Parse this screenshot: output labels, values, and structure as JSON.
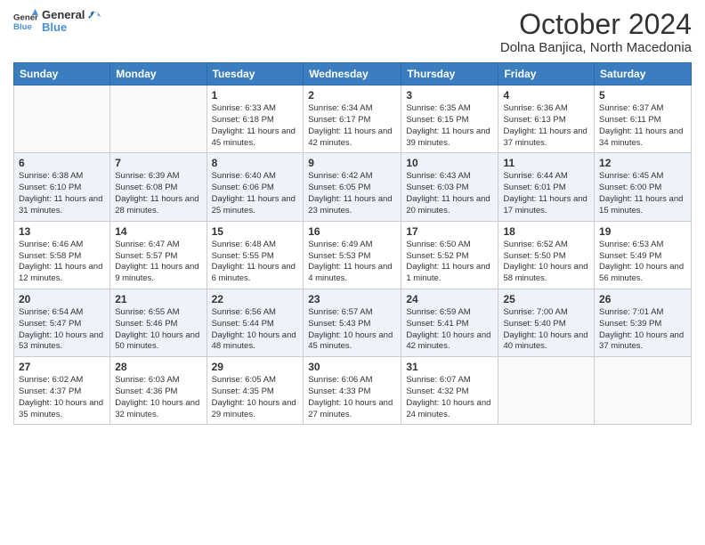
{
  "header": {
    "logo_line1": "General",
    "logo_line2": "Blue",
    "title": "October 2024",
    "subtitle": "Dolna Banjica, North Macedonia"
  },
  "days_of_week": [
    "Sunday",
    "Monday",
    "Tuesday",
    "Wednesday",
    "Thursday",
    "Friday",
    "Saturday"
  ],
  "weeks": [
    [
      {
        "day": "",
        "sunrise": "",
        "sunset": "",
        "daylight": "",
        "empty": true
      },
      {
        "day": "",
        "sunrise": "",
        "sunset": "",
        "daylight": "",
        "empty": true
      },
      {
        "day": "1",
        "sunrise": "Sunrise: 6:33 AM",
        "sunset": "Sunset: 6:18 PM",
        "daylight": "Daylight: 11 hours and 45 minutes.",
        "empty": false
      },
      {
        "day": "2",
        "sunrise": "Sunrise: 6:34 AM",
        "sunset": "Sunset: 6:17 PM",
        "daylight": "Daylight: 11 hours and 42 minutes.",
        "empty": false
      },
      {
        "day": "3",
        "sunrise": "Sunrise: 6:35 AM",
        "sunset": "Sunset: 6:15 PM",
        "daylight": "Daylight: 11 hours and 39 minutes.",
        "empty": false
      },
      {
        "day": "4",
        "sunrise": "Sunrise: 6:36 AM",
        "sunset": "Sunset: 6:13 PM",
        "daylight": "Daylight: 11 hours and 37 minutes.",
        "empty": false
      },
      {
        "day": "5",
        "sunrise": "Sunrise: 6:37 AM",
        "sunset": "Sunset: 6:11 PM",
        "daylight": "Daylight: 11 hours and 34 minutes.",
        "empty": false
      }
    ],
    [
      {
        "day": "6",
        "sunrise": "Sunrise: 6:38 AM",
        "sunset": "Sunset: 6:10 PM",
        "daylight": "Daylight: 11 hours and 31 minutes.",
        "empty": false
      },
      {
        "day": "7",
        "sunrise": "Sunrise: 6:39 AM",
        "sunset": "Sunset: 6:08 PM",
        "daylight": "Daylight: 11 hours and 28 minutes.",
        "empty": false
      },
      {
        "day": "8",
        "sunrise": "Sunrise: 6:40 AM",
        "sunset": "Sunset: 6:06 PM",
        "daylight": "Daylight: 11 hours and 25 minutes.",
        "empty": false
      },
      {
        "day": "9",
        "sunrise": "Sunrise: 6:42 AM",
        "sunset": "Sunset: 6:05 PM",
        "daylight": "Daylight: 11 hours and 23 minutes.",
        "empty": false
      },
      {
        "day": "10",
        "sunrise": "Sunrise: 6:43 AM",
        "sunset": "Sunset: 6:03 PM",
        "daylight": "Daylight: 11 hours and 20 minutes.",
        "empty": false
      },
      {
        "day": "11",
        "sunrise": "Sunrise: 6:44 AM",
        "sunset": "Sunset: 6:01 PM",
        "daylight": "Daylight: 11 hours and 17 minutes.",
        "empty": false
      },
      {
        "day": "12",
        "sunrise": "Sunrise: 6:45 AM",
        "sunset": "Sunset: 6:00 PM",
        "daylight": "Daylight: 11 hours and 15 minutes.",
        "empty": false
      }
    ],
    [
      {
        "day": "13",
        "sunrise": "Sunrise: 6:46 AM",
        "sunset": "Sunset: 5:58 PM",
        "daylight": "Daylight: 11 hours and 12 minutes.",
        "empty": false
      },
      {
        "day": "14",
        "sunrise": "Sunrise: 6:47 AM",
        "sunset": "Sunset: 5:57 PM",
        "daylight": "Daylight: 11 hours and 9 minutes.",
        "empty": false
      },
      {
        "day": "15",
        "sunrise": "Sunrise: 6:48 AM",
        "sunset": "Sunset: 5:55 PM",
        "daylight": "Daylight: 11 hours and 6 minutes.",
        "empty": false
      },
      {
        "day": "16",
        "sunrise": "Sunrise: 6:49 AM",
        "sunset": "Sunset: 5:53 PM",
        "daylight": "Daylight: 11 hours and 4 minutes.",
        "empty": false
      },
      {
        "day": "17",
        "sunrise": "Sunrise: 6:50 AM",
        "sunset": "Sunset: 5:52 PM",
        "daylight": "Daylight: 11 hours and 1 minute.",
        "empty": false
      },
      {
        "day": "18",
        "sunrise": "Sunrise: 6:52 AM",
        "sunset": "Sunset: 5:50 PM",
        "daylight": "Daylight: 10 hours and 58 minutes.",
        "empty": false
      },
      {
        "day": "19",
        "sunrise": "Sunrise: 6:53 AM",
        "sunset": "Sunset: 5:49 PM",
        "daylight": "Daylight: 10 hours and 56 minutes.",
        "empty": false
      }
    ],
    [
      {
        "day": "20",
        "sunrise": "Sunrise: 6:54 AM",
        "sunset": "Sunset: 5:47 PM",
        "daylight": "Daylight: 10 hours and 53 minutes.",
        "empty": false
      },
      {
        "day": "21",
        "sunrise": "Sunrise: 6:55 AM",
        "sunset": "Sunset: 5:46 PM",
        "daylight": "Daylight: 10 hours and 50 minutes.",
        "empty": false
      },
      {
        "day": "22",
        "sunrise": "Sunrise: 6:56 AM",
        "sunset": "Sunset: 5:44 PM",
        "daylight": "Daylight: 10 hours and 48 minutes.",
        "empty": false
      },
      {
        "day": "23",
        "sunrise": "Sunrise: 6:57 AM",
        "sunset": "Sunset: 5:43 PM",
        "daylight": "Daylight: 10 hours and 45 minutes.",
        "empty": false
      },
      {
        "day": "24",
        "sunrise": "Sunrise: 6:59 AM",
        "sunset": "Sunset: 5:41 PM",
        "daylight": "Daylight: 10 hours and 42 minutes.",
        "empty": false
      },
      {
        "day": "25",
        "sunrise": "Sunrise: 7:00 AM",
        "sunset": "Sunset: 5:40 PM",
        "daylight": "Daylight: 10 hours and 40 minutes.",
        "empty": false
      },
      {
        "day": "26",
        "sunrise": "Sunrise: 7:01 AM",
        "sunset": "Sunset: 5:39 PM",
        "daylight": "Daylight: 10 hours and 37 minutes.",
        "empty": false
      }
    ],
    [
      {
        "day": "27",
        "sunrise": "Sunrise: 6:02 AM",
        "sunset": "Sunset: 4:37 PM",
        "daylight": "Daylight: 10 hours and 35 minutes.",
        "empty": false
      },
      {
        "day": "28",
        "sunrise": "Sunrise: 6:03 AM",
        "sunset": "Sunset: 4:36 PM",
        "daylight": "Daylight: 10 hours and 32 minutes.",
        "empty": false
      },
      {
        "day": "29",
        "sunrise": "Sunrise: 6:05 AM",
        "sunset": "Sunset: 4:35 PM",
        "daylight": "Daylight: 10 hours and 29 minutes.",
        "empty": false
      },
      {
        "day": "30",
        "sunrise": "Sunrise: 6:06 AM",
        "sunset": "Sunset: 4:33 PM",
        "daylight": "Daylight: 10 hours and 27 minutes.",
        "empty": false
      },
      {
        "day": "31",
        "sunrise": "Sunrise: 6:07 AM",
        "sunset": "Sunset: 4:32 PM",
        "daylight": "Daylight: 10 hours and 24 minutes.",
        "empty": false
      },
      {
        "day": "",
        "sunrise": "",
        "sunset": "",
        "daylight": "",
        "empty": true
      },
      {
        "day": "",
        "sunrise": "",
        "sunset": "",
        "daylight": "",
        "empty": true
      }
    ]
  ]
}
